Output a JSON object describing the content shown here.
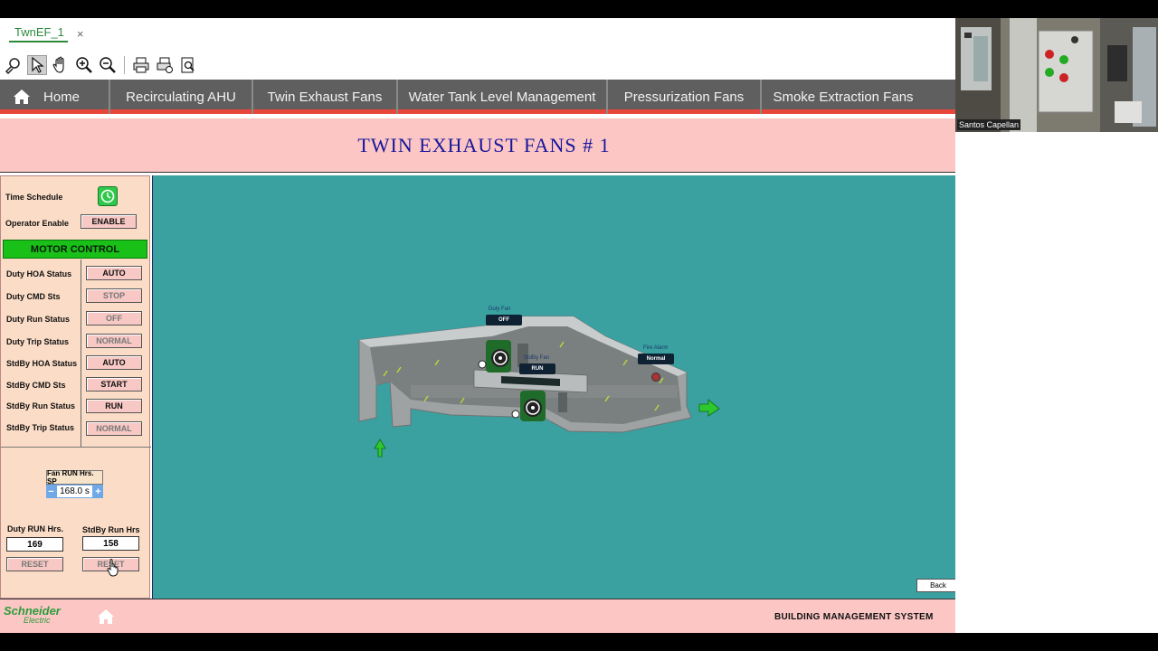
{
  "doc_tab": {
    "name": "TwnEF_1",
    "close": "×"
  },
  "toolbar": {
    "tools": [
      "wrench-search-icon",
      "pointer-icon",
      "pan-hand-icon",
      "zoom-in-icon",
      "zoom-out-icon",
      "print-icon",
      "print-settings-icon",
      "print-preview-icon"
    ]
  },
  "nav": {
    "home_label": "Home",
    "items": [
      "Recirculating AHU",
      "Twin Exhaust Fans",
      "Water Tank Level Management",
      "Pressurization Fans",
      "Smoke Extraction Fans"
    ]
  },
  "title": "TWIN EXHAUST FANS # 1",
  "panel": {
    "time_schedule_label": "Time Schedule",
    "operator_enable_label": "Operator Enable",
    "operator_enable_value": "ENABLE",
    "motor_control": "MOTOR CONTROL",
    "rows": [
      {
        "label": "Duty HOA Status",
        "value": "AUTO"
      },
      {
        "label": "Duty CMD Sts",
        "value": "STOP"
      },
      {
        "label": "Duty Run Status",
        "value": "OFF"
      },
      {
        "label": "Duty Trip Status",
        "value": "NORMAL"
      },
      {
        "label": "StdBy HOA Status",
        "value": "AUTO"
      },
      {
        "label": "StdBy CMD Sts",
        "value": "START"
      },
      {
        "label": "StdBy  Run Status",
        "value": "RUN"
      },
      {
        "label": "StdBy  Trip Status",
        "value": "NORMAL"
      }
    ],
    "sp_label": "Fan RUN Hrs. SP",
    "sp_value": "168.0 s",
    "sp_minus": "−",
    "sp_plus": "+",
    "duty_run_label": "Duty RUN Hrs.",
    "stdby_run_label": "StdBy Run Hrs",
    "duty_run_value": "169",
    "stdby_run_value": "158",
    "reset_label": "RESET",
    "reset2_label": "RESET"
  },
  "diagram": {
    "duty_fan_label": "Duty Fan",
    "duty_fan_state": "OFF",
    "stdby_fan_label": "StdBy Fan",
    "stdby_fan_state": "RUN",
    "fire_alarm_label": "Fire Alarm",
    "fire_alarm_state": "Normal",
    "back_label": "Back"
  },
  "footer": {
    "logo_line1": "Schneider",
    "logo_line2": "Electric",
    "bms": "BUILDING MANAGEMENT SYSTEM"
  },
  "webcam": {
    "caption": "Santos Capellan"
  },
  "colors": {
    "accent_green": "#18c018",
    "nav_bg": "#5f5f5f",
    "nav_underline": "#e8453b",
    "title_blue": "#16169c",
    "canvas": "#3aa0a0"
  }
}
